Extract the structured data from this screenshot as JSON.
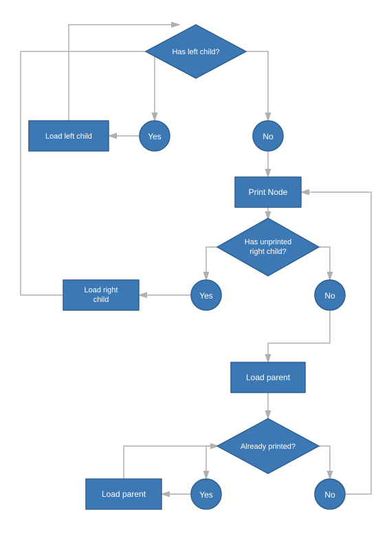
{
  "shape_color": "#3c78b4",
  "shape_stroke": "#2e5f90",
  "connector_color": "#b0b0b0",
  "nodes": {
    "d1": {
      "type": "decision",
      "text": "Has left child?"
    },
    "c1a": {
      "type": "connector",
      "text": "Yes"
    },
    "c1b": {
      "type": "connector",
      "text": "No"
    },
    "p1": {
      "type": "process",
      "text": "Load left child"
    },
    "p2": {
      "type": "process",
      "text": "Print Node"
    },
    "d2": {
      "type": "decision",
      "text_line1": "Has unprinted",
      "text_line2": "right child?"
    },
    "c2a": {
      "type": "connector",
      "text": "Yes"
    },
    "c2b": {
      "type": "connector",
      "text": "No"
    },
    "p3": {
      "type": "process",
      "text_line1": "Load right",
      "text_line2": "child"
    },
    "p4": {
      "type": "process",
      "text": "Load parent"
    },
    "d3": {
      "type": "decision",
      "text": "Already printed?"
    },
    "c3a": {
      "type": "connector",
      "text": "Yes"
    },
    "c3b": {
      "type": "connector",
      "text": "No"
    },
    "p5": {
      "type": "process",
      "text": "Load parent"
    }
  }
}
